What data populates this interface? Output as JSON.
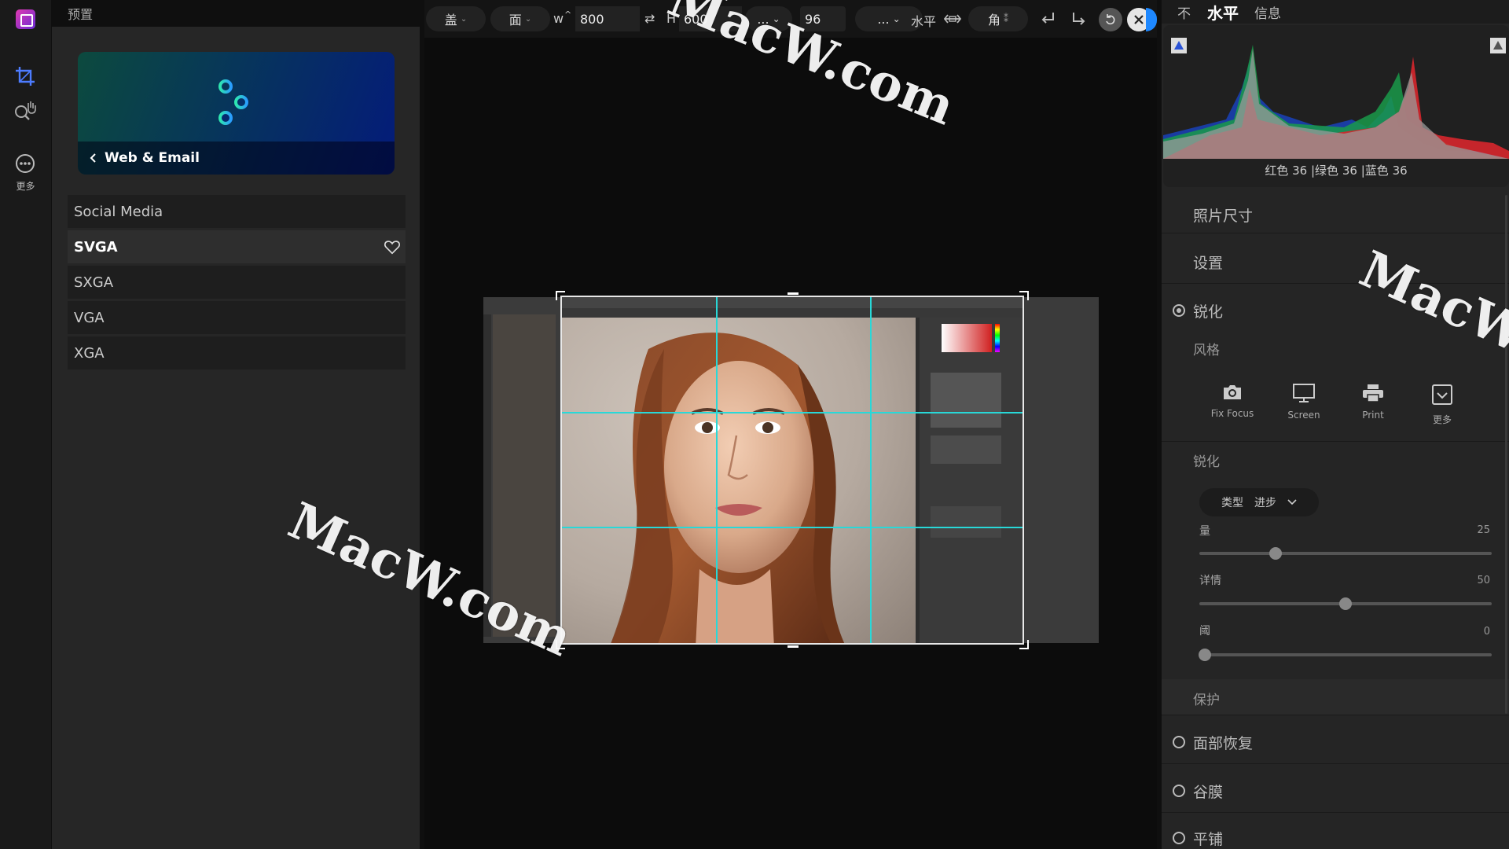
{
  "rail": {
    "more_label": "更多"
  },
  "presets": {
    "title": "预置",
    "banner_label": "Web & Email",
    "items": [
      {
        "label": "Social Media",
        "active": false
      },
      {
        "label": "SVGA",
        "active": true
      },
      {
        "label": "SXGA",
        "active": false
      },
      {
        "label": "VGA",
        "active": false
      },
      {
        "label": "XGA",
        "active": false
      }
    ]
  },
  "toolbar": {
    "btn1": "盖",
    "btn2": "面",
    "w_label": "w",
    "w_value": "800",
    "h_label": "H",
    "h_value": "600",
    "ellipsis1": "...",
    "dpi_value": "96",
    "ellipsis2": "...",
    "level_label": "水平",
    "angle_label": "角",
    "accent": "#1e88ff"
  },
  "right": {
    "tabs": [
      "不",
      "水平",
      "信息"
    ],
    "histogram": {
      "red_label": "红色",
      "red": "36",
      "green_label": "绿色",
      "green": "36",
      "blue_label": "蓝色",
      "blue": "36"
    },
    "photo_size": "照片尺寸",
    "settings": "设置",
    "sharpen_title": "锐化",
    "style_title": "风格",
    "styles": [
      {
        "label": "Fix Focus",
        "icon": "camera-icon"
      },
      {
        "label": "Screen",
        "icon": "monitor-icon"
      },
      {
        "label": "Print",
        "icon": "printer-icon"
      },
      {
        "label": "更多",
        "icon": "more-icon"
      }
    ],
    "sharpen_sub": "锐化",
    "type_label": "类型",
    "type_value": "进步",
    "sliders": [
      {
        "label": "量",
        "value": "25",
        "fraction": 0.26
      },
      {
        "label": "详情",
        "value": "50",
        "fraction": 0.5
      },
      {
        "label": "阈",
        "value": "0",
        "fraction": 0.02
      }
    ],
    "protect": "保护",
    "face_restore": "面部恢复",
    "film_grain": "谷膜",
    "tile": "平铺"
  },
  "watermark": "MacW.com"
}
